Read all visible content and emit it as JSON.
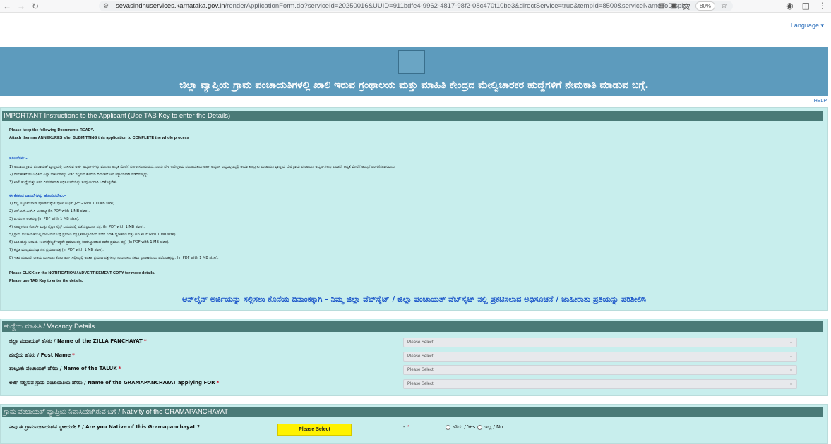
{
  "browser": {
    "url_host": "sevasindhuservices.karnataka.gov.in",
    "url_path": "/renderApplicationForm.do?serviceId=20250016&UUID=911bdfe4-9962-4817-98f2-08c470f10be3&directService=true&tempId=8500&serviceNameToDisplay",
    "zoom": "80%"
  },
  "header": {
    "language_label": "Language",
    "title": "ಜಿಲ್ಲಾ ವ್ಯಾಪ್ತಿಯ ಗ್ರಾಮ ಪಂಚಾಯತಿಗಳಲ್ಲಿ ಖಾಲಿ ಇರುವ ಗ್ರಂಥಾಲಯ ಮತ್ತು ಮಾಹಿತಿ ಕೇಂದ್ರದ ಮೇಲ್ವಿಚಾರಕರ ಹುದ್ದೆಗಳಿಗೆ ನೇಮಕಾತಿ ಮಾಡುವ ಬಗ್ಗೆ.",
    "help_label": "HELP"
  },
  "instructions": {
    "heading": "IMPORTANT Instructions to the Applicant (Use TAB Key to enter the Details)",
    "intro": [
      "Please keep the following Documents READY.",
      "Attach them as ANNEXURES after SUBMITTING this application to COMPLETE the whole process"
    ],
    "notes_heading": "ಸೂಚನೆಗಳು:-",
    "notes": [
      "1) ಅಂದಾಜು ಗ್ರಾಮ ಪಂಚಾಯತ್ ವ್ಯಾಪ್ತಿಯಲ್ಲಿ ವಾಸಿಸುವ ಅರ್ಹ ಅಭ್ಯರ್ಥಿಗಳನ್ನು ಮೊದಲು ಆದ್ಯತೆ ಮೇರೆಗೆ ಪರಿಗಣಿಸಲಾಗುವುದು. ಒಂದು ವೇಳೆ ಅದೇ ಗ್ರಾಮ ಪಂಚಾಯತಿಯ ಅರ್ಹ ಅಭ್ಯರ್ಥಿ ಲಭ್ಯವಿಲ್ಲದಿದ್ದಲ್ಲಿ ಆಯಾ ತಾಲ್ಲೂಕು ಪಂಚಾಯತಿ ವ್ಯಾಪ್ತಿಯ ಬೇರೆ ಗ್ರಾಮ ಪಂಚಾಯತಿ ಅಭ್ಯರ್ಥಿಗಳನ್ನು ಎರಡನೇ ಆದ್ಯತೆ ಮೇರೆಗೆ ಆಯ್ಕೆಗೆ ಪರಿಗಣಿಸಲಾಗುವುದು.",
      "2) ನೇಮಕಾತಿಗೆ ಸಂಬಂಧಿಸಿದ ಎಲ್ಲಾ ದಾಖಲೆಗಳನ್ನು ಅರ್ಜಿ ಸಲ್ಲಿಸುವ ಕೊನೆಯ ದಿನಾಂಕದೊಳಗೆ ಕಡ್ಡಾಯವಾಗಿ ಪಡೆದಿರತಕ್ಕದ್ದು.",
      "3) ಖಾಲಿ ಹುದ್ದೆ ಮತ್ತು ಇತರ ವಿವರಗಳಿಗಾಗಿ ಅಧಿಸೂಚನೆಯನ್ನು ಸಂಪೂರ್ಣವಾಗಿ ಓದಿಕೊಳ್ಳಬೇಕು."
    ],
    "documents_heading": "ಈ ಕೆಳಕಂಡ ದಾಖಲೆಗಳನ್ನು ಹೊಂದಿರಬೇಕು:-",
    "documents": [
      "1) ನಿಲ್ಲ ಇತ್ತೀಚಿನ ಪಾಸ್ ಪೋರ್ಟ್ ಸೈಜ್ ಫೋಟೋ (In JPEG with 100 KB size).",
      "2) ಎಸ್.ಎಸ್.ಎಲ್.ಸಿ ಅಂಕಪಟ್ಟಿ (In PDF with 1 MB size).",
      "3) ಪಿ.ಯು.ಸಿ ಅಂಕಪಟ್ಟಿ (In PDF with 1 MB size).",
      "4) ಸಹಿಷ್ಣೀಕರಣ ಕೋರ್ಸ್ ಮತ್ತು ಲೈಬ್ರರಿ ಸೈನ್ಸ್ ವಿಷಯದಲ್ಲಿ ಪಡೆದ ಪ್ರಮಾಣ ಪತ್ರ. (In PDF with 1 MB size).",
      "5) ಗ್ರಾಮ ಪಂಚಾಯತಿಯಲ್ಲಿ ವಾಸವಿರುವ ಬಗ್ಗೆ ಪ್ರಮಾಣ ಪತ್ರ (ತಹಸಿಲ್ದಾರರಿಂದ ಪಡೆದ ನಿವಾಸಿ ದೃಢೀಕರಣ ಪತ್ರ) (In PDF with 1 MB size).",
      "6) ಜಾತಿ ಮತ್ತು ಆದಾಯ (ಅಂಗವೈಕಲ್ಯತೆ ಇದ್ದರೆ) ಪ್ರಮಾಣ ಪತ್ರ (ತಹಸಿಲ್ದಾರರಿಂದ ಪಡೆದ ಪ್ರಮಾಣ ಪತ್ರ) (In PDF with 1 MB size).",
      "7) ಕನ್ನಡ ಮಾಧ್ಯಮದ ವ್ಯಾಸಂಗ ಪ್ರಮಾಣ ಪತ್ರ (In PDF with 1 MB size).",
      "8) ಇತರ ಯಾವುದೇ ರೀತಿಯ ಮೀಸಲಾತಿ ಕೋರಿ ಅರ್ಜಿ ಸಲ್ಲಿಸಿದ್ದಲ್ಲಿ ಅಂತಹ ಪ್ರಮಾಣ ಪತ್ರಗಳನ್ನು ಸಂಬಂಧಿಸಿದ ಸಕ್ಷಮ ಪ್ರಾಧಿಕಾರದಿಂದ ಪಡೆದಿರತಕ್ಕದ್ದು. (In PDF with 1 MB size)."
    ],
    "outro": [
      "Please CLICK on the NOTIFICATION / ADVERTISEMENT COPY for more details.",
      "Please use TAB Key to enter the details."
    ],
    "announcement": "ಆನ್‌ಲೈನ್ ಅರ್ಜಿಯನ್ನು ಸಲ್ಲಿಸಲು ಕೊನೆಯ ದಿನಾಂಕಕ್ಕಾಗಿ - ನಿಮ್ಮ ಜಿಲ್ಲಾ ವೆಬ್‌ಸೈಟ್ / ಜಿಲ್ಲಾ ಪಂಚಾಯತ್ ವೆಬ್‌ಸೈಟ್ ನಲ್ಲಿ ಪ್ರಕಟಿಸಲಾದ ಅಧಿಸೂಚನೆ / ಜಾಹೀರಾತು ಪ್ರತಿಯನ್ನು ಪರಿಶೀಲಿಸಿ"
  },
  "vacancy": {
    "heading": "ಹುದ್ದೆಯ ಮಾಹಿತಿ / Vacancy Details",
    "fields": [
      {
        "label": "ಜಿಲ್ಲಾ ಪಂಚಾಯತ್ ಹೆಸರು / Name of the ZILLA PANCHAYAT",
        "value": "Please Select"
      },
      {
        "label": "ಹುದ್ದೆಯ ಹೆಸರು / Post Name",
        "value": "Please Select"
      },
      {
        "label": "ತಾಲ್ಲೂಕು ಪಂಚಾಯತ್ ಹೆಸರು / Name of the TALUK",
        "value": "Please Select"
      },
      {
        "label": "ಅರ್ಜಿ ಸಲ್ಲಿಸುವ ಗ್ರಾಮ ಪಂಚಾಯತಿಯ ಹೆಸರು / Name of the GRAMAPANCHAYAT applying FOR",
        "value": "Please Select"
      }
    ],
    "required_mark": "*"
  },
  "nativity": {
    "heading": "ಗ್ರಾಮ ಪಂಚಾಯತ್ ವ್ಯಾಪ್ತಿಯ ನಿವಾಸಿಯಾಗಿರುವ ಬಗ್ಗೆ / Nativity of the GRAMAPANCHAYAT",
    "question": "ನೀವು ಈ ಗ್ರಾಮಪಂಚಾಯತ್‌ನ ಸ್ಥಳೀಯರೇ ? / Are you Native of this Gramapanchayat ?",
    "button": "Please Select",
    "colon": ":-",
    "required_mark": "*",
    "yes": "ಹೌದು / Yes",
    "no": "ಇಲ್ಲ / No"
  }
}
